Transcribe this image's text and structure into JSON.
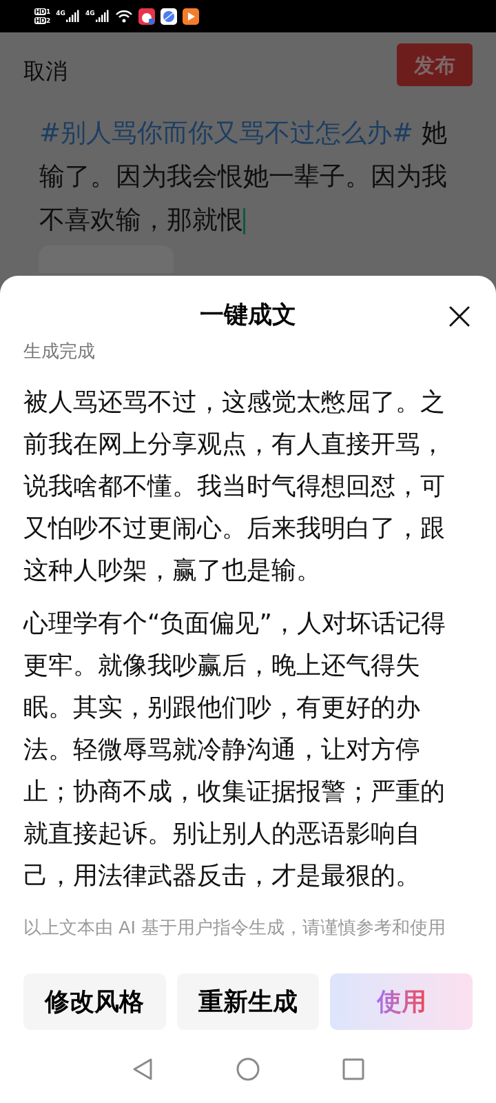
{
  "status_bar": {
    "sim_labels": [
      {
        "main": "HD",
        "sub": "1"
      },
      {
        "main": "HD",
        "sub": "2"
      }
    ],
    "network": [
      "4G",
      "4G"
    ]
  },
  "editor": {
    "cancel": "取消",
    "publish": "发布",
    "hashtag": "#别人骂你而你又骂不过怎么办#",
    "body": " 她输了。因为我会恨她一辈子。因为我不喜欢输，那就恨"
  },
  "sheet": {
    "title": "一键成文",
    "status": "生成完成",
    "paragraphs": [
      "被人骂还骂不过，这感觉太憋屈了。之前我在网上分享观点，有人直接开骂，说我啥都不懂。我当时气得想回怼，可又怕吵不过更闹心。后来我明白了，跟这种人吵架，赢了也是输。",
      "心理学有个“负面偏见”，人对坏话记得更牢。就像我吵赢后，晚上还气得失眠。其实，别跟他们吵，有更好的办法。轻微辱骂就冷静沟通，让对方停止；协商不成，收集证据报警；严重的就直接起诉。别让别人的恶语影响自己，用法律武器反击，才是最狠的。"
    ],
    "disclaimer": "以上文本由 AI 基于用户指令生成，请谨慎参考和使用",
    "buttons": [
      {
        "label": "修改风格",
        "kind": "plain"
      },
      {
        "label": "重新生成",
        "kind": "plain"
      },
      {
        "label": "使用",
        "kind": "primary"
      }
    ]
  }
}
